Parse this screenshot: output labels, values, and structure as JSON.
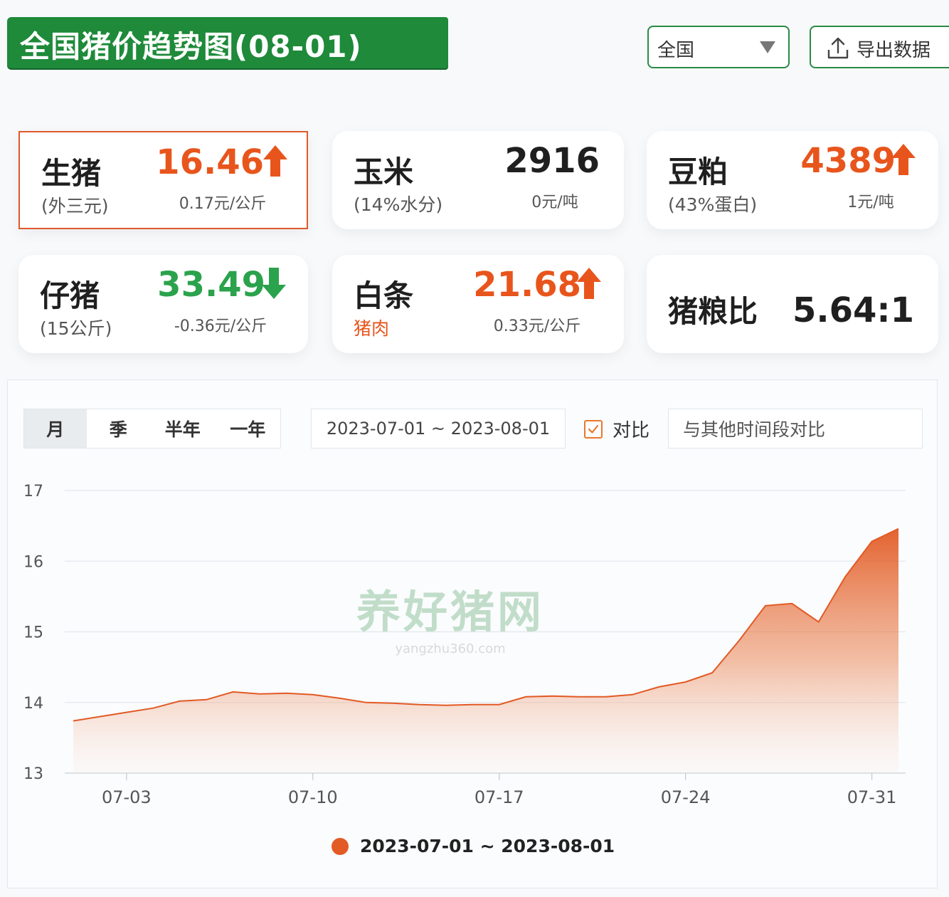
{
  "header": {
    "title": "全国猪价趋势图(08-01)",
    "region_select": "全国",
    "export_label": "导出数据"
  },
  "cards": [
    {
      "name": "生猪",
      "sub": "(外三元)",
      "value": "16.46",
      "change": "0.17元/公斤",
      "trend": "up",
      "selected": true
    },
    {
      "name": "玉米",
      "sub": "(14%水分)",
      "value": "2916",
      "change": "0元/吨",
      "trend": "none"
    },
    {
      "name": "豆粕",
      "sub": "(43%蛋白)",
      "value": "4389",
      "change": "1元/吨",
      "trend": "up"
    },
    {
      "name": "仔猪",
      "sub": "(15公斤)",
      "value": "33.49",
      "change": "-0.36元/公斤",
      "trend": "down"
    },
    {
      "name": "白条",
      "sub": "猪肉",
      "value": "21.68",
      "change": "0.33元/公斤",
      "trend": "up"
    },
    {
      "name": "猪粮比",
      "sub": "",
      "value": "5.64:1",
      "change": "",
      "trend": "none"
    }
  ],
  "controls": {
    "periods": [
      "月",
      "季",
      "半年",
      "一年"
    ],
    "active_period": "月",
    "date_range": "2023-07-01 ~ 2023-08-01",
    "compare_label": "对比",
    "compare_checked": true,
    "compare_placeholder": "与其他时间段对比"
  },
  "watermark": {
    "main": "养好猪网",
    "site": "yangzhu360.com"
  },
  "colors": {
    "brand_green": "#1e8a3a",
    "up": "#e8551c",
    "down": "#2ba24c",
    "series": "#e25a24"
  },
  "chart_data": {
    "type": "area",
    "x": [
      "07-01",
      "07-02",
      "07-03",
      "07-04",
      "07-05",
      "07-06",
      "07-07",
      "07-08",
      "07-09",
      "07-10",
      "07-11",
      "07-12",
      "07-13",
      "07-14",
      "07-15",
      "07-16",
      "07-17",
      "07-18",
      "07-19",
      "07-20",
      "07-21",
      "07-22",
      "07-23",
      "07-24",
      "07-25",
      "07-26",
      "07-27",
      "07-28",
      "07-29",
      "07-30",
      "07-31",
      "08-01"
    ],
    "x_ticks": [
      "07-03",
      "07-10",
      "07-17",
      "07-24",
      "07-31"
    ],
    "ylim": [
      13,
      17
    ],
    "y_ticks": [
      13,
      14,
      15,
      16,
      17
    ],
    "series": [
      {
        "name": "2023-07-01 ~ 2023-08-01",
        "values": [
          13.74,
          13.8,
          13.86,
          13.92,
          14.02,
          14.04,
          14.15,
          14.12,
          14.13,
          14.11,
          14.06,
          14.0,
          13.99,
          13.97,
          13.96,
          13.97,
          13.97,
          14.08,
          14.09,
          14.08,
          14.08,
          14.11,
          14.22,
          14.29,
          14.42,
          14.87,
          15.37,
          15.4,
          15.14,
          15.78,
          16.28,
          16.46
        ]
      }
    ],
    "legend": "bottom-center",
    "grid": true
  }
}
